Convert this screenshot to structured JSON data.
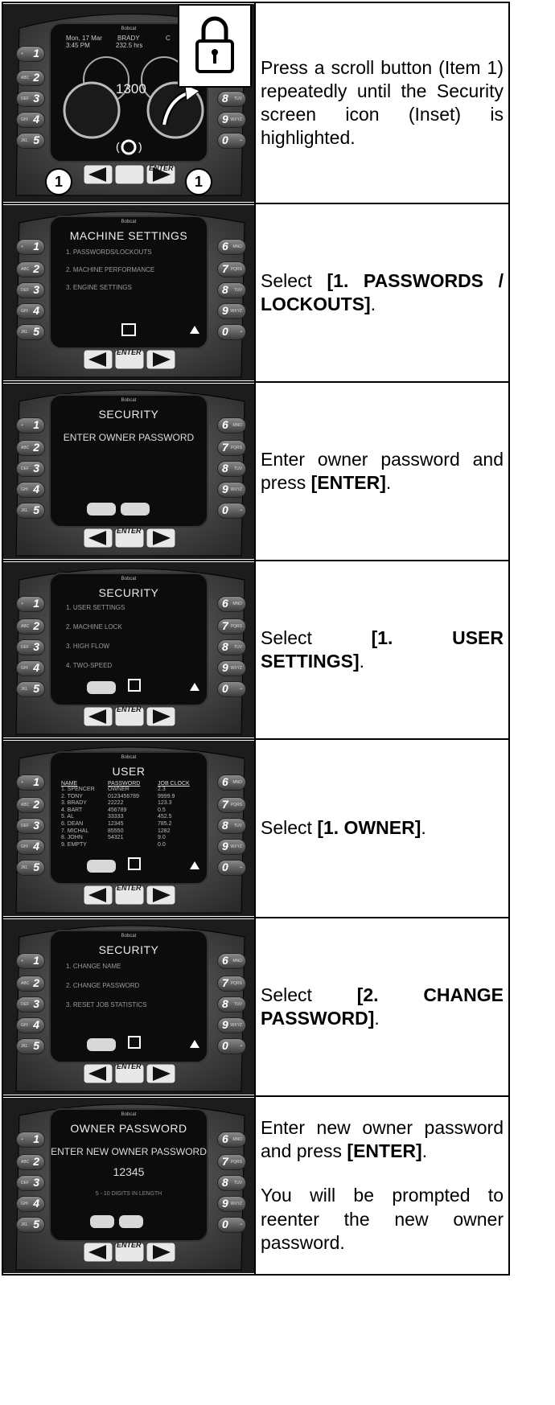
{
  "steps": [
    {
      "text": "Press a scroll button (Item 1) repeatedly until the Security screen icon (Inset) is highlighted.",
      "screen": {
        "logo": "Bobcat",
        "date": "Mon, 17 Mar",
        "time": "3:45 PM",
        "operator": "BRADY",
        "hours": "232.5 hrs",
        "extra": "C",
        "rpm": "1300",
        "callout_left": "1",
        "callout_right": "1"
      }
    },
    {
      "text_prefix": "Select ",
      "text_bold": "[1. PASSWORDS / LOCKOUTS]",
      "text_suffix": ".",
      "screen": {
        "logo": "Bobcat",
        "title": "MACHINE SETTINGS",
        "lines": [
          "1. PASSWORDS/LOCKOUTS",
          "2. MACHINE PERFORMANCE",
          "3. ENGINE SETTINGS"
        ]
      }
    },
    {
      "text_prefix": "Enter owner password and press ",
      "text_bold": "[ENTER]",
      "text_suffix": ".",
      "screen": {
        "logo": "Bobcat",
        "title": "SECURITY",
        "prompt": "ENTER OWNER PASSWORD"
      }
    },
    {
      "text_prefix": "Select ",
      "text_bold": "[1. USER SETTINGS]",
      "text_suffix": ".",
      "screen": {
        "logo": "Bobcat",
        "title": "SECURITY",
        "lines": [
          "1. USER SETTINGS",
          "2. MACHINE LOCK",
          "3. HIGH FLOW",
          "4. TWO-SPEED"
        ]
      }
    },
    {
      "text_prefix": "Select ",
      "text_bold": "[1. OWNER]",
      "text_suffix": ".",
      "screen": {
        "logo": "Bobcat",
        "title": "USER",
        "columns": [
          "NAME",
          "PASSWORD",
          "JOB CLOCK"
        ],
        "rows": [
          [
            "1. SPENCER",
            "OWNER",
            "2.3"
          ],
          [
            "2. TONY",
            "0123456789",
            "9999.9"
          ],
          [
            "3. BRADY",
            "22222",
            "123.3"
          ],
          [
            "4. BART",
            "456789",
            "0.5"
          ],
          [
            "5. AL",
            "33333",
            "452.5"
          ],
          [
            "6. DEAN",
            "12345",
            "785.2"
          ],
          [
            "7. MICHAL",
            "85550",
            "1282"
          ],
          [
            "8. JOHN",
            "54321",
            "9.0"
          ],
          [
            "9. EMPTY",
            "",
            "0.0"
          ]
        ]
      }
    },
    {
      "text_prefix": "Select ",
      "text_bold": "[2. CHANGE PASSWORD]",
      "text_suffix": ".",
      "screen": {
        "logo": "Bobcat",
        "title": "SECURITY",
        "lines": [
          "1. CHANGE NAME",
          "2. CHANGE PASSWORD",
          "3. RESET JOB STATISTICS"
        ]
      }
    },
    {
      "text_prefix": "Enter new owner password and press ",
      "text_bold": "[ENTER]",
      "text_suffix": ".",
      "text_2": "You will be prompted to reenter the new owner password.",
      "screen": {
        "logo": "Bobcat",
        "title": "OWNER PASSWORD",
        "prompt": "ENTER NEW OWNER PASSWORD",
        "value": "12345",
        "hint": "5 - 10 DIGITS IN LENGTH"
      }
    }
  ],
  "keypad": {
    "left": [
      {
        "num": "1",
        "sub": "+"
      },
      {
        "num": "2",
        "sub": "ABC"
      },
      {
        "num": "3",
        "sub": "DEF"
      },
      {
        "num": "4",
        "sub": "GHI"
      },
      {
        "num": "5",
        "sub": "JKL"
      }
    ],
    "right": [
      {
        "num": "6",
        "sub": "MNO"
      },
      {
        "num": "7",
        "sub": "PQRS"
      },
      {
        "num": "8",
        "sub": "TUV"
      },
      {
        "num": "9",
        "sub": "WXYZ"
      },
      {
        "num": "0",
        "sub": "-•"
      }
    ],
    "enter_label": "ENTER"
  },
  "colors": {
    "bezel": "#5a5a5a",
    "screen": "#0c0c0c",
    "screen_text": "#ececec"
  }
}
